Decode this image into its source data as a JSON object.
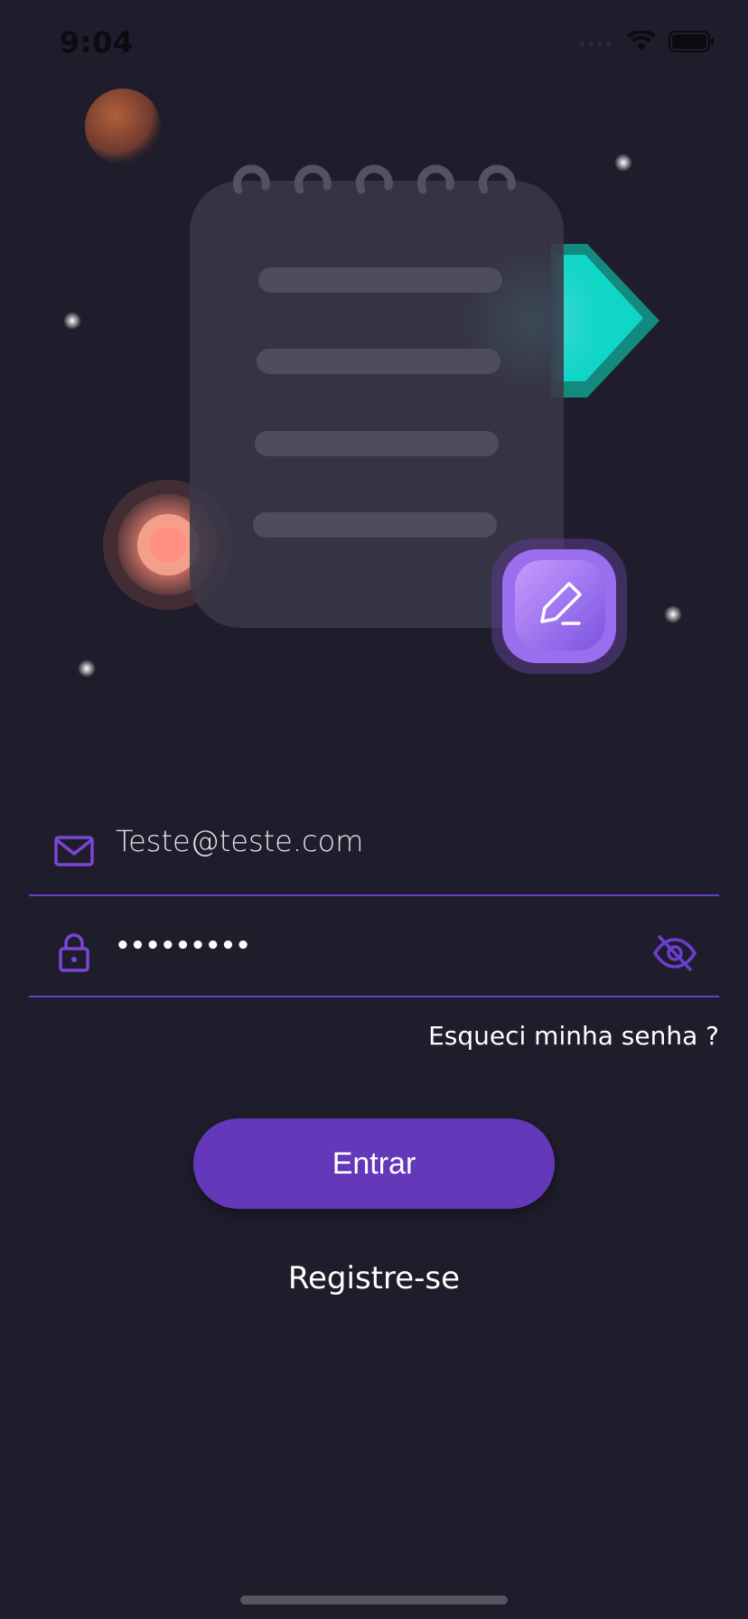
{
  "status_bar": {
    "time": "9:04"
  },
  "illustration": {
    "icons": [
      "notepad-icon",
      "edit-pencil-icon",
      "play-arrow-icon",
      "planet-icon",
      "target-circle-icon",
      "star-icon"
    ]
  },
  "form": {
    "email": {
      "value": "Teste@teste.com",
      "icon": "mail-icon"
    },
    "password": {
      "value": "•••••••••",
      "icon": "lock-icon",
      "toggle_icon": "eye-off-icon"
    },
    "forgot_password_label": "Esqueci minha senha ?",
    "submit_label": "Entrar",
    "register_label": "Registre-se"
  },
  "colors": {
    "background": "#1f1d2b",
    "accent": "#6439b9",
    "field_line": "#6a3fcf",
    "icon": "#7b45d6"
  }
}
